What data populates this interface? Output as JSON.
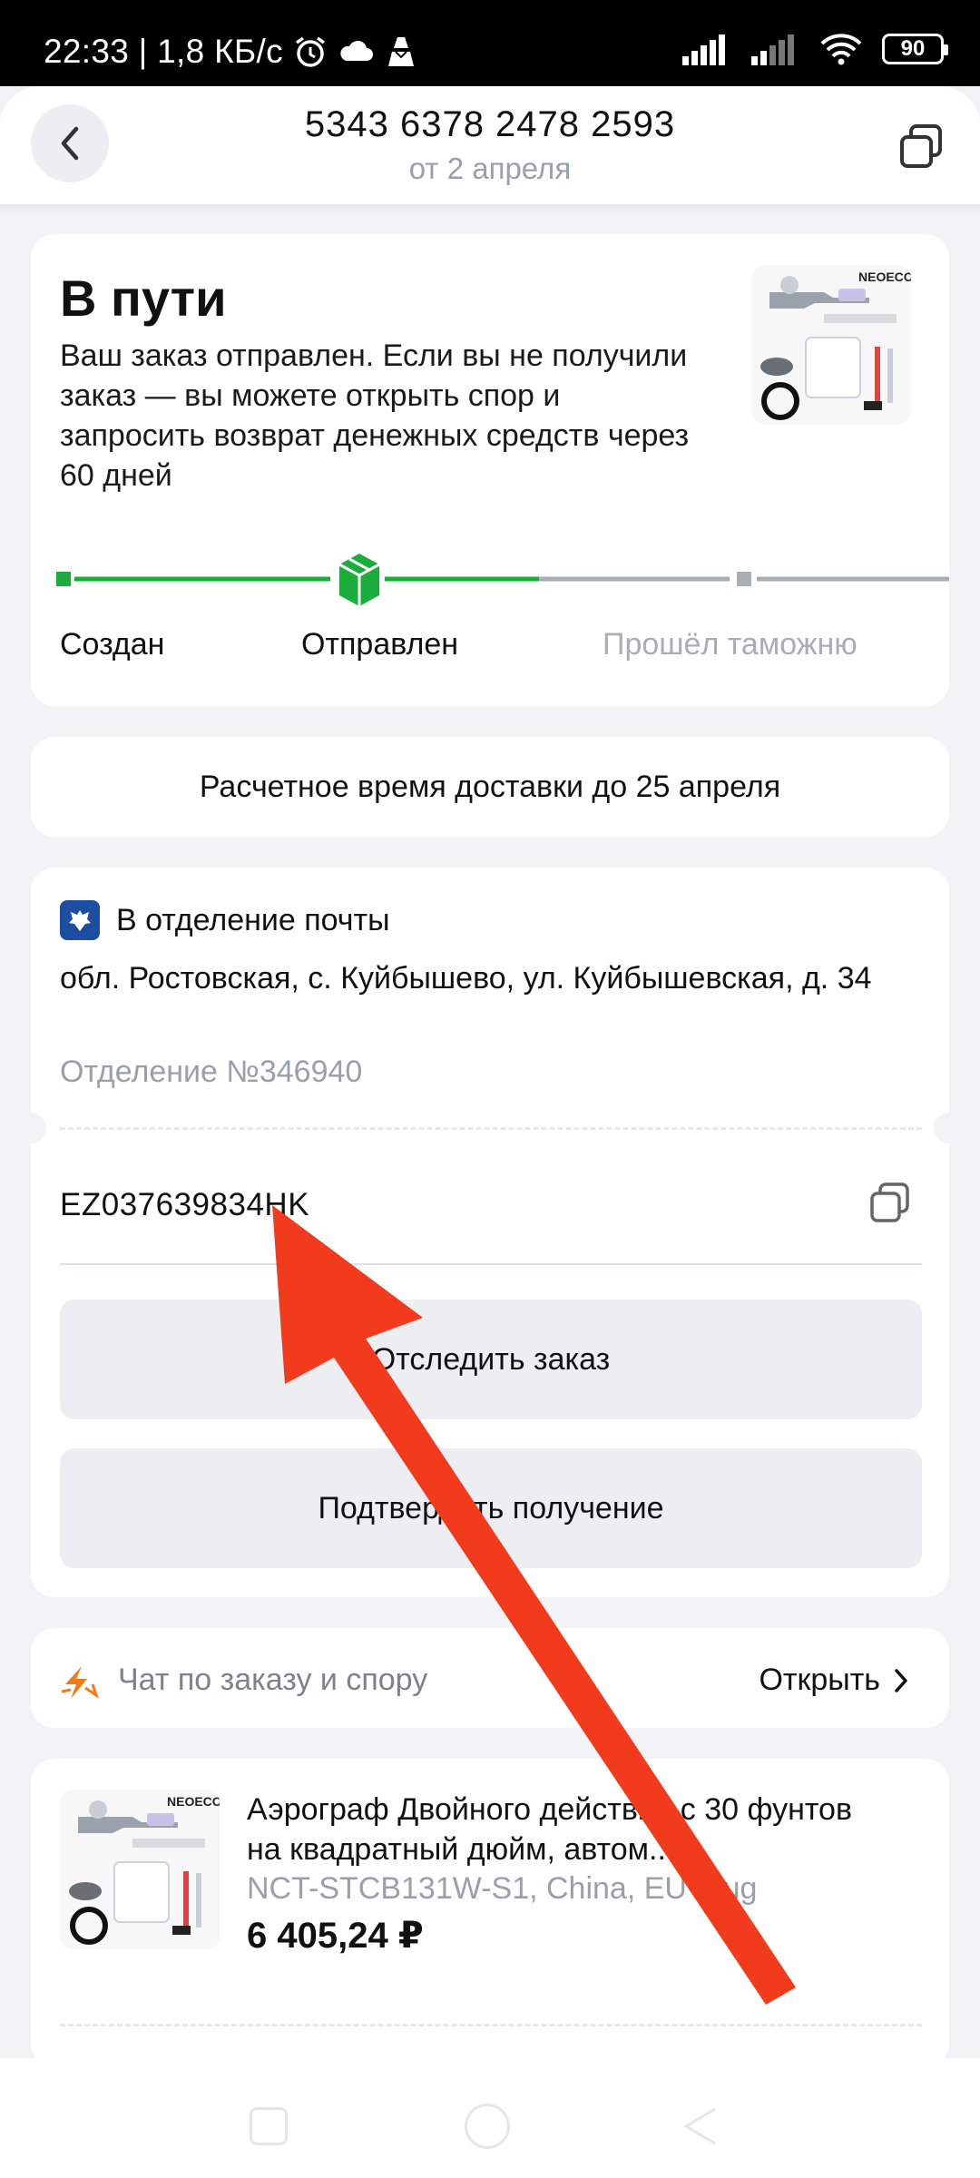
{
  "status_bar": {
    "time_speed": "22:33 | 1,8 КБ/с",
    "battery": "90"
  },
  "header": {
    "order_number": "5343 6378 2478 2593",
    "order_date": "от 2 апреля"
  },
  "status_card": {
    "title": "В пути",
    "description": "Ваш заказ отправлен. Если вы не получили заказ — вы можете открыть спор и запросить возврат денежных средств через 60 дней",
    "thumb_brand": "NEOECO",
    "steps": [
      {
        "label": "Создан"
      },
      {
        "label": "Отправлен"
      },
      {
        "label": "Прошёл таможню"
      }
    ],
    "accent_color": "#1aad3c"
  },
  "delivery": {
    "estimate": "Расчетное время доставки до 25 апреля"
  },
  "address_card": {
    "method": "В отделение почты",
    "address": "обл. Ростовская, с. Куйбышево, ул. Куйбышевская, д. 34",
    "office": "Отделение №346940",
    "tracking_number": "EZ037639834HK",
    "track_button": "Отследить заказ",
    "confirm_button": "Подтвердить получение"
  },
  "chat": {
    "label": "Чат по заказу и спору",
    "open_label": "Открыть"
  },
  "product": {
    "name": "Аэрограф Двойного действия с 30 фунтов на квадратный дюйм, автом...",
    "variant": "NCT-STCB131W-S1, China, EU Plug",
    "price": "6 405,24 ₽",
    "brand": "NEOECO"
  },
  "annotation": {
    "arrow_color": "#f23a1c"
  }
}
